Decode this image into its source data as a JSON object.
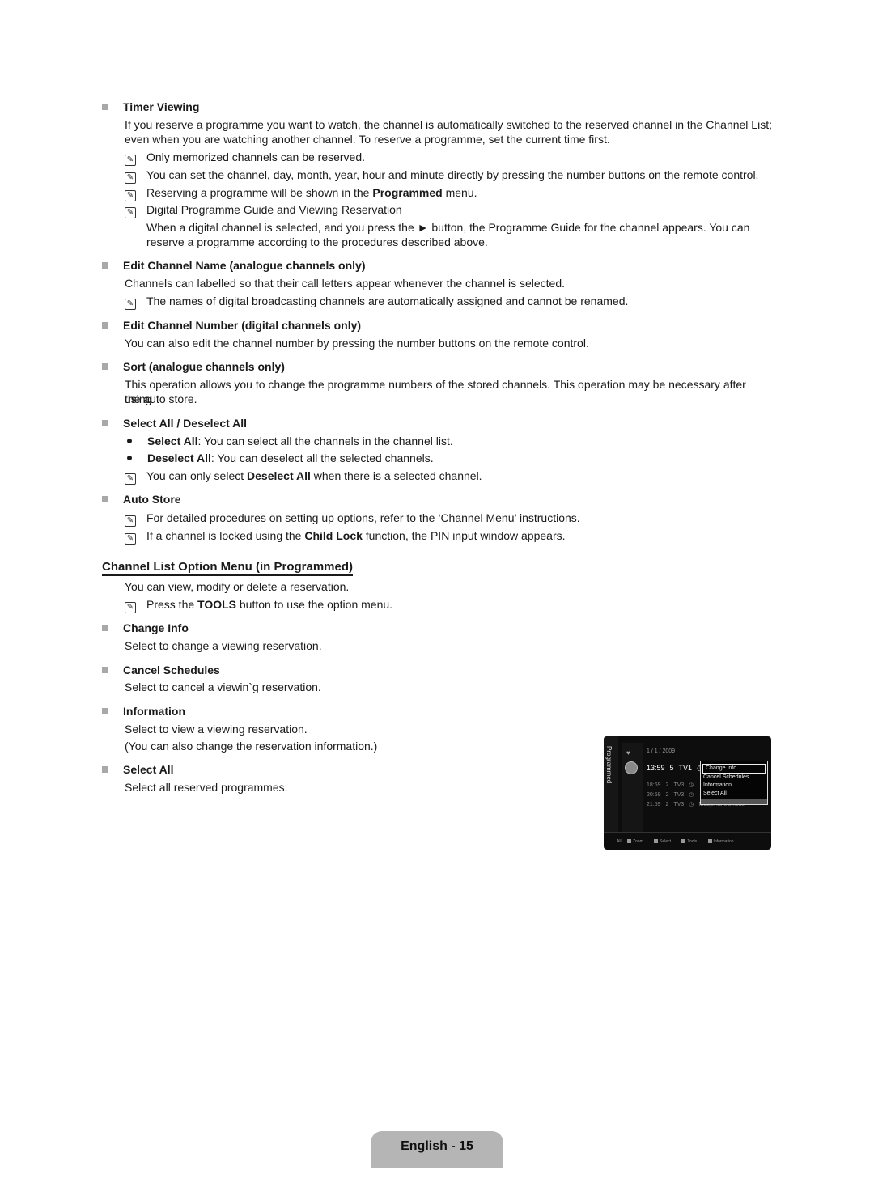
{
  "sections": {
    "timer_viewing": {
      "heading": "Timer Viewing",
      "para_1": "If you reserve a programme you want to watch, the channel is automatically switched to the reserved channel in the Channel List;",
      "para_2": "even when you are watching another channel. To reserve a programme, set the current time first.",
      "note_1": "Only memorized channels can be reserved.",
      "note_2": "You can set the channel, day, month, year, hour and minute directly by pressing the number buttons on the remote control.",
      "note_3_pre": "Reserving a programme will be shown in the ",
      "note_3_bold": "Programmed",
      "note_3_post": " menu.",
      "note_4": "Digital Programme Guide and Viewing Reservation",
      "note_4_sub_1": "When a digital channel is selected, and you press the ► button, the Programme Guide for the channel appears. You can",
      "note_4_sub_2": "reserve a programme according to the procedures described above."
    },
    "edit_name": {
      "heading": "Edit Channel Name (analogue channels only)",
      "para": "Channels can labelled so that their call letters appear whenever the channel is selected.",
      "note": "The names of digital broadcasting channels are automatically assigned and cannot be renamed."
    },
    "edit_number": {
      "heading": "Edit Channel Number (digital channels only)",
      "para": "You can also edit the channel number by pressing the number buttons on the remote control."
    },
    "sort": {
      "heading": "Sort (analogue channels only)",
      "para_1": "This operation allows you to change the programme numbers of the stored channels. This operation may be necessary after using",
      "para_2": "the auto store."
    },
    "select_all": {
      "heading": "Select All / Deselect All",
      "bullet_1_bold": "Select All",
      "bullet_1_text": ": You can select all the channels in the channel list.",
      "bullet_2_bold": "Deselect All",
      "bullet_2_text": ": You can deselect all the selected channels.",
      "note_pre": "You can only select ",
      "note_bold": "Deselect All",
      "note_post": " when there is a selected channel."
    },
    "auto_store": {
      "heading": "Auto Store",
      "note_1": "For detailed procedures on setting up options, refer to the ‘Channel Menu’ instructions.",
      "note_2_pre": "If a channel is locked using the ",
      "note_2_bold": "Child Lock",
      "note_2_post": " function, the PIN input window appears."
    }
  },
  "option_menu": {
    "title": "Channel List Option Menu (in Programmed)",
    "intro": "You can view, modify or delete a reservation.",
    "note_pre": "Press the ",
    "note_bold": "TOOLS",
    "note_post": " button to use the option menu.",
    "items": [
      {
        "heading": "Change Info",
        "text": "Select to change a viewing reservation."
      },
      {
        "heading": "Cancel Schedules",
        "text": "Select to cancel a viewin`g reservation."
      },
      {
        "heading": "Information",
        "text": "Select to view a viewing reservation.",
        "text_2": "(You can also change the reservation information.)"
      },
      {
        "heading": "Select All",
        "text": "Select all reserved programmes."
      }
    ]
  },
  "tv_screen": {
    "side_label": "Programmed",
    "date": "1 / 1 / 2009",
    "rows": [
      {
        "time": "13:59",
        "ch": "5",
        "name": "TV1"
      },
      {
        "time": "18:59",
        "ch": "2",
        "name": "TV3"
      },
      {
        "time": "20:59",
        "ch": "2",
        "name": "TV3"
      },
      {
        "time": "21:59",
        "ch": "2",
        "name": "TV3",
        "title": "McSpinane's mike"
      }
    ],
    "popup": [
      "Change Info",
      "Cancel Schedules",
      "Information",
      "Select All"
    ],
    "footer": {
      "all": "All",
      "zoom": "Zoom",
      "select": "Select",
      "tools": "Tools",
      "info": "Information"
    }
  },
  "footer": {
    "page_label": "English - 15"
  }
}
